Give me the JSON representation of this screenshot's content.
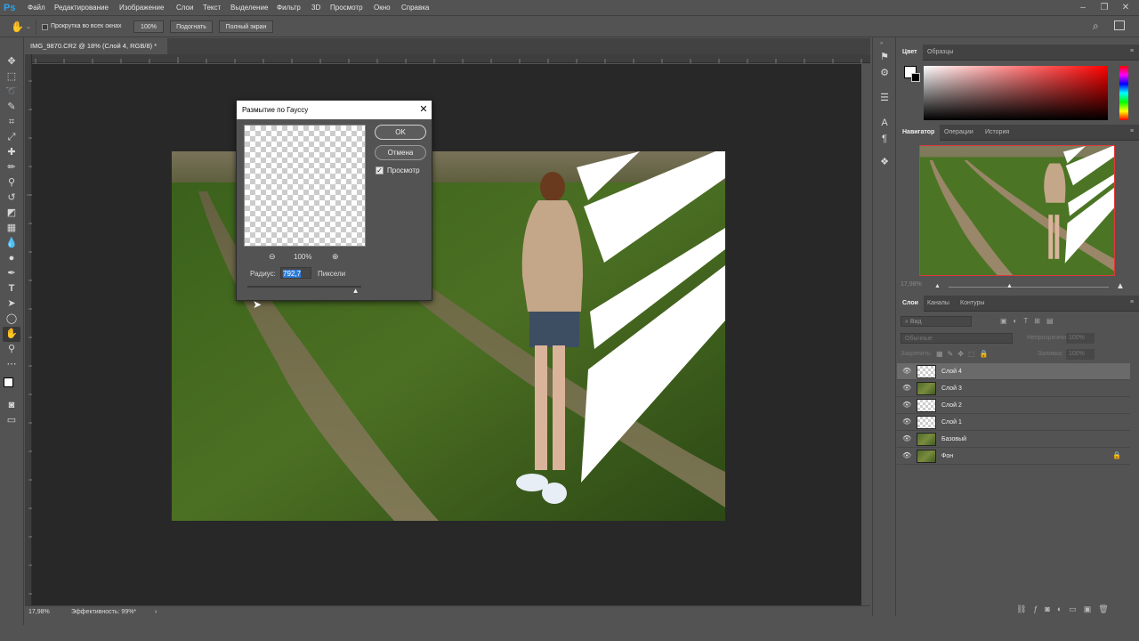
{
  "app": {
    "logo": "Ps"
  },
  "menu": [
    "Файл",
    "Редактирование",
    "Изображение",
    "Слои",
    "Текст",
    "Выделение",
    "Фильтр",
    "3D",
    "Просмотр",
    "Окно",
    "Справка"
  ],
  "options": {
    "scroll_all_label": "Прокрутка во всех окнах",
    "zoom_btn": "100%",
    "fit_btn": "Подогнать",
    "fullscreen_btn": "Полный экран"
  },
  "document": {
    "tab_title": "IMG_9870.CR2 @ 18% (Слой 4, RGB/8) *",
    "zoom": "17,98%",
    "efficiency": "Эффективность: 99%*"
  },
  "dialog": {
    "title": "Размытие по Гауссу",
    "ok": "OK",
    "cancel": "Отмена",
    "preview_label": "Просмотр",
    "preview_checked": true,
    "zoom": "100%",
    "radius_label": "Радиус:",
    "radius_value": "792,7",
    "unit": "Пиксели",
    "slider_fraction": 0.95
  },
  "panels": {
    "color": {
      "tabs": [
        "Цвет",
        "Образцы"
      ]
    },
    "navigator": {
      "tabs": [
        "Навигатор",
        "Операции",
        "История"
      ],
      "zoom": "17,98%"
    },
    "layers": {
      "tabs": [
        "Слои",
        "Каналы",
        "Контуры"
      ],
      "search_placeholder": "Вид",
      "blend_mode": "Обычные",
      "opacity_label": "Непрозрачность:",
      "opacity_value": "100%",
      "lock_label": "Закрепить:",
      "fill_label": "Заливка:",
      "fill_value": "100%",
      "items": [
        {
          "name": "Слой 4",
          "thumb": "transparent",
          "selected": true
        },
        {
          "name": "Слой 3",
          "thumb": "photo",
          "selected": false
        },
        {
          "name": "Слой 2",
          "thumb": "transparent",
          "selected": false
        },
        {
          "name": "Слой 1",
          "thumb": "transparent",
          "selected": false
        },
        {
          "name": "Базовый",
          "thumb": "photo",
          "selected": false
        },
        {
          "name": "Фон",
          "thumb": "photo",
          "selected": false,
          "locked": true
        }
      ]
    }
  },
  "colors": {
    "accent": "#2fa3e7",
    "highlight": "#2d7bd8",
    "navigator_frame": "#e0383a"
  }
}
